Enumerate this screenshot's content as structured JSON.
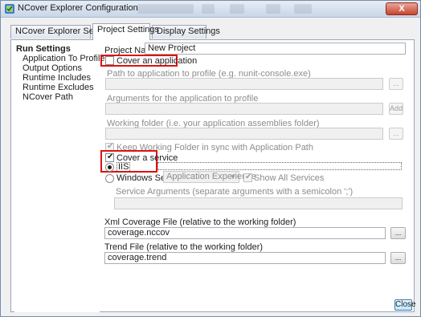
{
  "window": {
    "title": "NCover Explorer Configuration",
    "close_glyph": "X"
  },
  "tabs": [
    {
      "label": "NCover Explorer Settings",
      "active": false
    },
    {
      "label": "Project Settings",
      "active": true
    },
    {
      "label": "Display Settings",
      "active": false
    }
  ],
  "tree": {
    "root": "Run Settings",
    "items": [
      "Application To Profile",
      "Output Options",
      "Runtime Includes",
      "Runtime Excludes",
      "NCover Path"
    ]
  },
  "project": {
    "name_label": "Project Name",
    "name_value": "New Project"
  },
  "cover_application": {
    "label": "Cover an application",
    "checked": false,
    "path_label": "Path to application to profile (e.g. nunit-console.exe)",
    "path_value": "",
    "path_browse": "...",
    "args_label": "Arguments for the application to profile",
    "args_value": "",
    "args_add": "Add",
    "workdir_label": "Working folder (i.e. your application assemblies folder)",
    "workdir_value": "",
    "workdir_browse": "...",
    "keep_sync_label": "Keep Working Folder in sync with Application Path",
    "keep_sync_checked": true
  },
  "cover_service": {
    "label": "Cover a service",
    "checked": true,
    "iis_label": "IIS",
    "iis_selected": true,
    "windows_service_label": "Windows Service",
    "windows_service_selected": false,
    "windows_service_value": "Application Experience",
    "show_all_label": "Show All Services",
    "show_all_checked": true,
    "service_args_label": "Service Arguments (separate arguments with a semicolon ';')",
    "service_args_value": ""
  },
  "xml_coverage": {
    "label": "Xml Coverage File (relative to the working folder)",
    "value": "coverage.nccov",
    "browse": "..."
  },
  "trend_file": {
    "label": "Trend File (relative to the working folder)",
    "value": "coverage.trend",
    "browse": "..."
  },
  "close_button": "Close",
  "colors": {
    "highlight_box": "#e01010",
    "window_border": "#7a8ba3",
    "close_x": "#c7442f"
  }
}
